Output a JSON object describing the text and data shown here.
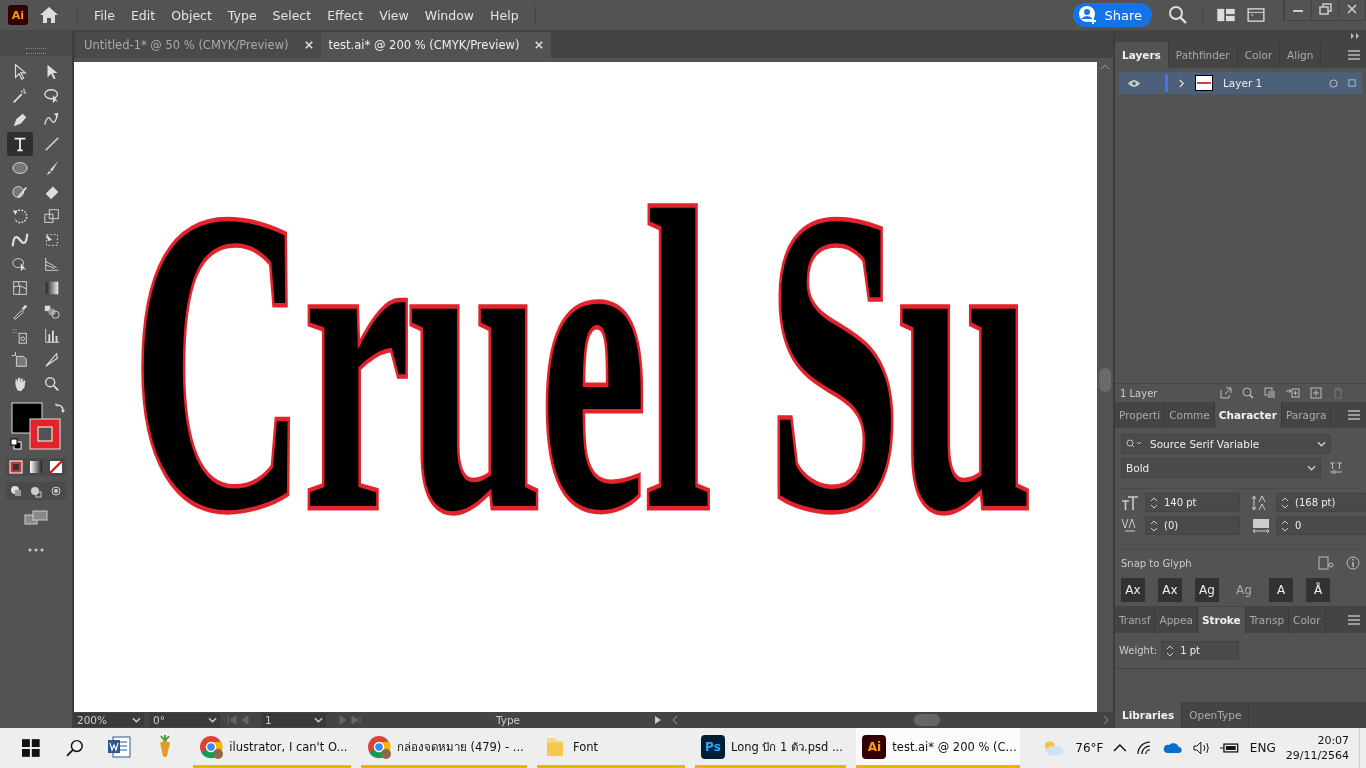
{
  "app": {
    "logo": "Ai"
  },
  "menu": [
    "File",
    "Edit",
    "Object",
    "Type",
    "Select",
    "Effect",
    "View",
    "Window",
    "Help"
  ],
  "share_button": "Share",
  "doc_tabs": [
    {
      "label": "Untitled-1* @ 50 % (CMYK/Preview)",
      "selected": false
    },
    {
      "label": "test.ai* @ 200 % (CMYK/Preview)",
      "selected": true
    }
  ],
  "tools": [
    {
      "kind": "selection",
      "selected": false
    },
    {
      "kind": "direct",
      "selected": false
    },
    {
      "kind": "wand",
      "selected": false
    },
    {
      "kind": "lasso",
      "selected": false
    },
    {
      "kind": "pen",
      "selected": false
    },
    {
      "kind": "curvature",
      "selected": false
    },
    {
      "kind": "type",
      "selected": true
    },
    {
      "kind": "line",
      "selected": false
    },
    {
      "kind": "ellipse",
      "selected": false
    },
    {
      "kind": "brush",
      "selected": false
    },
    {
      "kind": "shaper",
      "selected": false
    },
    {
      "kind": "eraser",
      "selected": false
    },
    {
      "kind": "rotate",
      "selected": false
    },
    {
      "kind": "scale",
      "selected": false
    },
    {
      "kind": "warp",
      "selected": false
    },
    {
      "kind": "transform",
      "selected": false
    },
    {
      "kind": "builder",
      "selected": false
    },
    {
      "kind": "perspective",
      "selected": false
    },
    {
      "kind": "mesh",
      "selected": false
    },
    {
      "kind": "gradient",
      "selected": false
    },
    {
      "kind": "eyedropper",
      "selected": false
    },
    {
      "kind": "blend",
      "selected": false
    },
    {
      "kind": "sprayer",
      "selected": false
    },
    {
      "kind": "graph",
      "selected": false
    },
    {
      "kind": "artboard",
      "selected": false
    },
    {
      "kind": "slice",
      "selected": false
    },
    {
      "kind": "hand",
      "selected": false
    },
    {
      "kind": "zoom",
      "selected": false
    }
  ],
  "canvas": {
    "text": "Cruel Su"
  },
  "layers_panel": {
    "tabs": [
      {
        "label": "Layers",
        "selected": true
      },
      {
        "label": "Pathfinder",
        "selected": false
      },
      {
        "label": "Color",
        "selected": false
      },
      {
        "label": "Align",
        "selected": false
      }
    ],
    "layers": [
      {
        "name": "Layer 1",
        "visible": true,
        "expanded": false
      }
    ],
    "count": "1 Layer"
  },
  "character_panel": {
    "tabs": [
      {
        "label": "Properti",
        "selected": false
      },
      {
        "label": "Comme",
        "selected": false
      },
      {
        "label": "Character",
        "selected": true
      },
      {
        "label": "Paragra",
        "selected": false
      }
    ],
    "font_family": "Source Serif Variable",
    "font_style": "Bold",
    "font_size": "140 pt",
    "leading": "(168 pt)",
    "kerning": "(0)",
    "tracking": "0",
    "snap_label": "Snap to Glyph",
    "snap_buttons": [
      {
        "label": "Ax",
        "on": true
      },
      {
        "label": "Ax",
        "on": true
      },
      {
        "label": "Ag",
        "on": true
      },
      {
        "label": "Ag",
        "on": false
      },
      {
        "label": "A",
        "on": true
      },
      {
        "label": "Å",
        "on": true
      }
    ]
  },
  "stroke_panel": {
    "tabs": [
      {
        "label": "Transf",
        "selected": false
      },
      {
        "label": "Appea",
        "selected": false
      },
      {
        "label": "Stroke",
        "selected": true
      },
      {
        "label": "Transp",
        "selected": false
      },
      {
        "label": "Color",
        "selected": false
      }
    ],
    "weight_label": "Weight:",
    "weight": "1 pt"
  },
  "bottom_tabs": [
    {
      "label": "Libraries",
      "selected": true
    },
    {
      "label": "OpenType",
      "selected": false
    }
  ],
  "status_bar": {
    "zoom": "200%",
    "rotation": "0°",
    "artboard": "1",
    "tool": "Type"
  },
  "taskbar": {
    "apps": [
      {
        "kind": "word",
        "open": false,
        "selected": false
      },
      {
        "kind": "mascot",
        "open": false,
        "selected": false
      },
      {
        "kind": "chrome",
        "label": "ilustrator, I can't O...",
        "open": true,
        "selected": false
      },
      {
        "kind": "chrome",
        "label": "กล่องจดหมาย (479) - ...",
        "open": true,
        "selected": false
      },
      {
        "kind": "folder",
        "label": "Font",
        "open": true,
        "selected": false
      },
      {
        "kind": "ps",
        "badge": "Ps",
        "label": "Long ปัก 1 ตัว.psd ...",
        "open": true,
        "selected": false
      },
      {
        "kind": "ai",
        "badge": "Ai",
        "label": "test.ai* @ 200 % (C...",
        "open": true,
        "selected": true
      }
    ],
    "weather": "76°F",
    "language": "ENG",
    "time": "20:07",
    "date": "29/11/2564"
  }
}
